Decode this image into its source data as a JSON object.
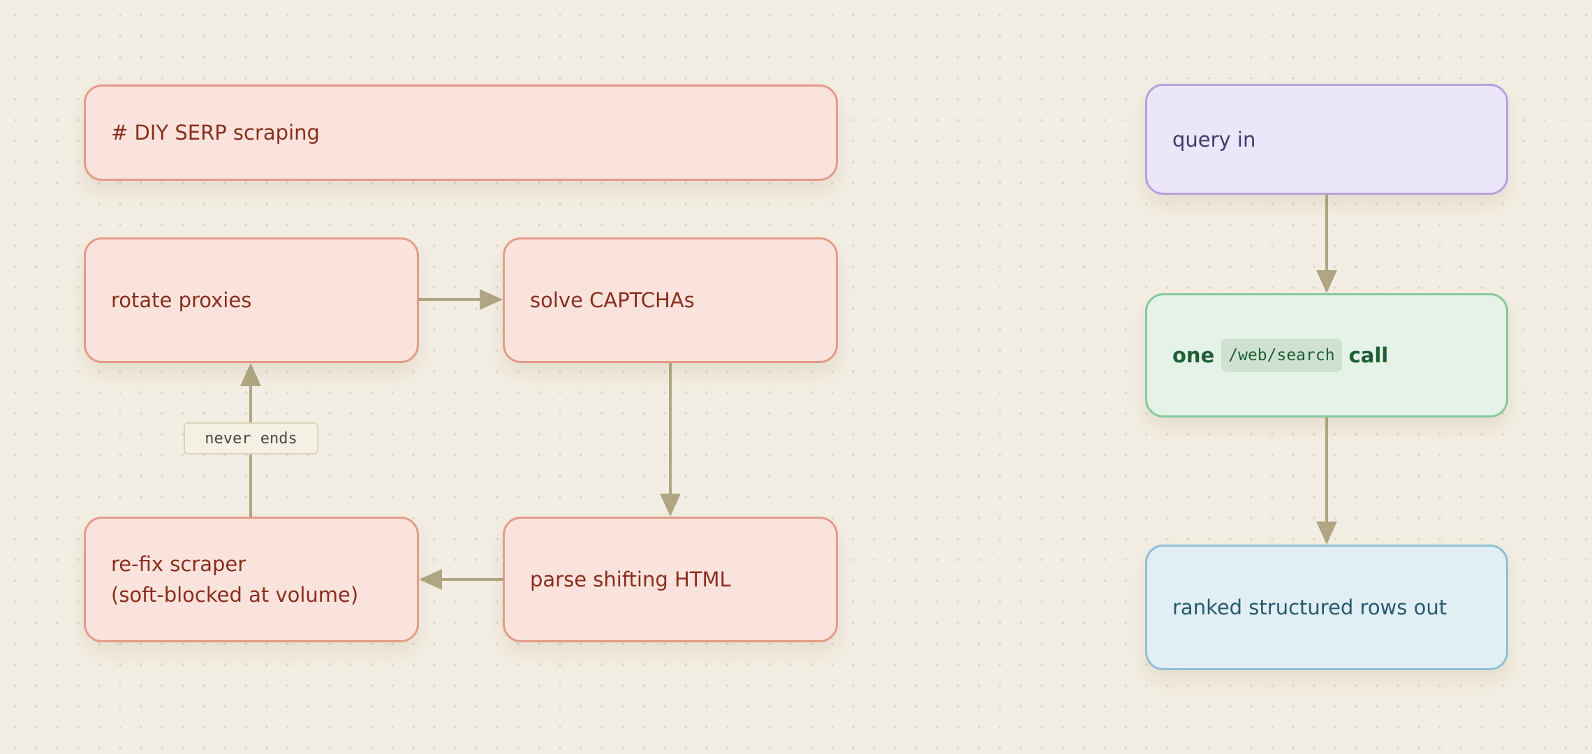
{
  "diy": {
    "title": "# DIY SERP scraping",
    "rotate": "rotate proxies",
    "captcha": "solve CAPTCHAs",
    "parse": "parse shifting HTML",
    "refix_line1": "re-fix scraper",
    "refix_line2": "(soft-blocked at volume)",
    "loop_label": "never ends"
  },
  "api": {
    "query": "query in",
    "call_prefix": "one",
    "call_code": "/web/search",
    "call_suffix": "call",
    "result": "ranked structured rows out"
  },
  "colors": {
    "arrow": "#b0a683",
    "red_fill": "#fae3dd",
    "red_border": "#e59a88",
    "purple_fill": "#ece7f8",
    "green_fill": "#e5f2e7",
    "blue_fill": "#e1eef3"
  }
}
